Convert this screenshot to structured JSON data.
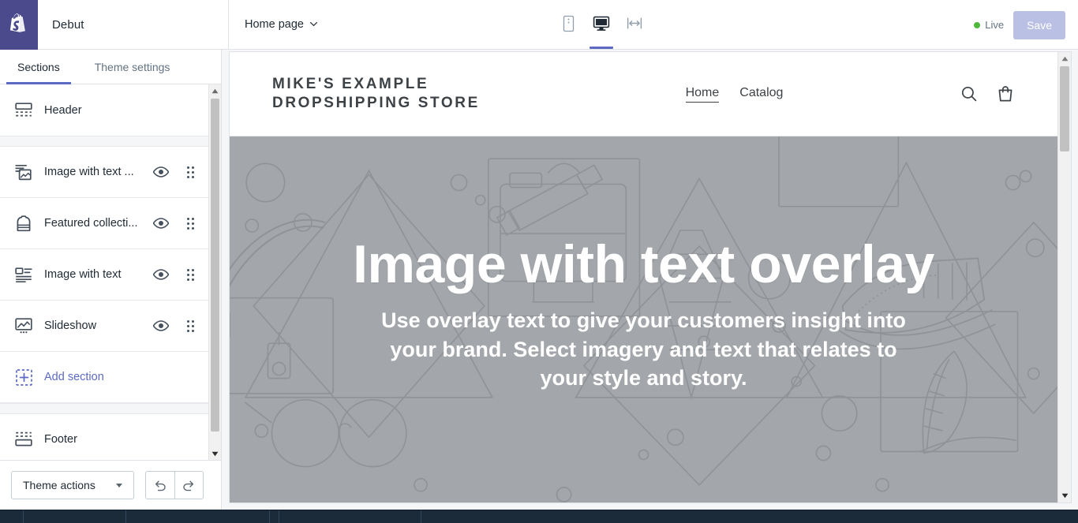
{
  "app": {
    "brand_icon": "shopify-bag-icon",
    "theme_name": "Debut",
    "accent_color": "#5c6ac4",
    "brand_color": "#4a4a8c"
  },
  "topbar": {
    "page_selector_label": "Home page",
    "page_selector_icon": "chevron-down-icon",
    "devices": [
      {
        "name": "mobile",
        "icon": "mobile-icon",
        "active": false
      },
      {
        "name": "desktop",
        "icon": "desktop-icon",
        "active": true
      },
      {
        "name": "full-width",
        "icon": "full-width-icon",
        "active": false
      }
    ],
    "status_label": "Live",
    "status_color": "#50b83c",
    "save_label": "Save"
  },
  "sidebar": {
    "tabs": [
      {
        "label": "Sections",
        "active": true
      },
      {
        "label": "Theme settings",
        "active": false
      }
    ],
    "sections": [
      {
        "label": "Header",
        "icon": "header-icon",
        "has_visibility": false,
        "has_drag": false
      },
      {
        "label": "Image with text ...",
        "icon": "image-with-text-overlay-icon",
        "has_visibility": true,
        "has_drag": true
      },
      {
        "label": "Featured collecti...",
        "icon": "featured-collection-icon",
        "has_visibility": true,
        "has_drag": true
      },
      {
        "label": "Image with text",
        "icon": "image-with-text-icon",
        "has_visibility": true,
        "has_drag": true
      },
      {
        "label": "Slideshow",
        "icon": "slideshow-icon",
        "has_visibility": true,
        "has_drag": true
      },
      {
        "label": "Add section",
        "icon": "add-section-icon",
        "has_visibility": false,
        "has_drag": false,
        "is_link": true
      },
      {
        "label": "Footer",
        "icon": "footer-icon",
        "has_visibility": false,
        "has_drag": false
      }
    ],
    "visibility_icon": "eye-icon",
    "drag_icon": "drag-handle-icon",
    "footer": {
      "theme_actions_label": "Theme actions",
      "theme_actions_icon": "caret-down-icon",
      "undo_icon": "undo-icon",
      "redo_icon": "redo-icon"
    }
  },
  "preview": {
    "store": {
      "title": "MIKE'S EXAMPLE DROPSHIPPING STORE",
      "nav": [
        {
          "label": "Home",
          "current": true
        },
        {
          "label": "Catalog",
          "current": false
        }
      ],
      "search_icon": "search-icon",
      "cart_icon": "shopping-bag-icon"
    },
    "hero": {
      "heading": "Image with text overlay",
      "body": "Use overlay text to give your customers insight into your brand. Select imagery and text that relates to your style and story.",
      "background_color": "#a3a6aa",
      "text_color": "#ffffff"
    }
  }
}
